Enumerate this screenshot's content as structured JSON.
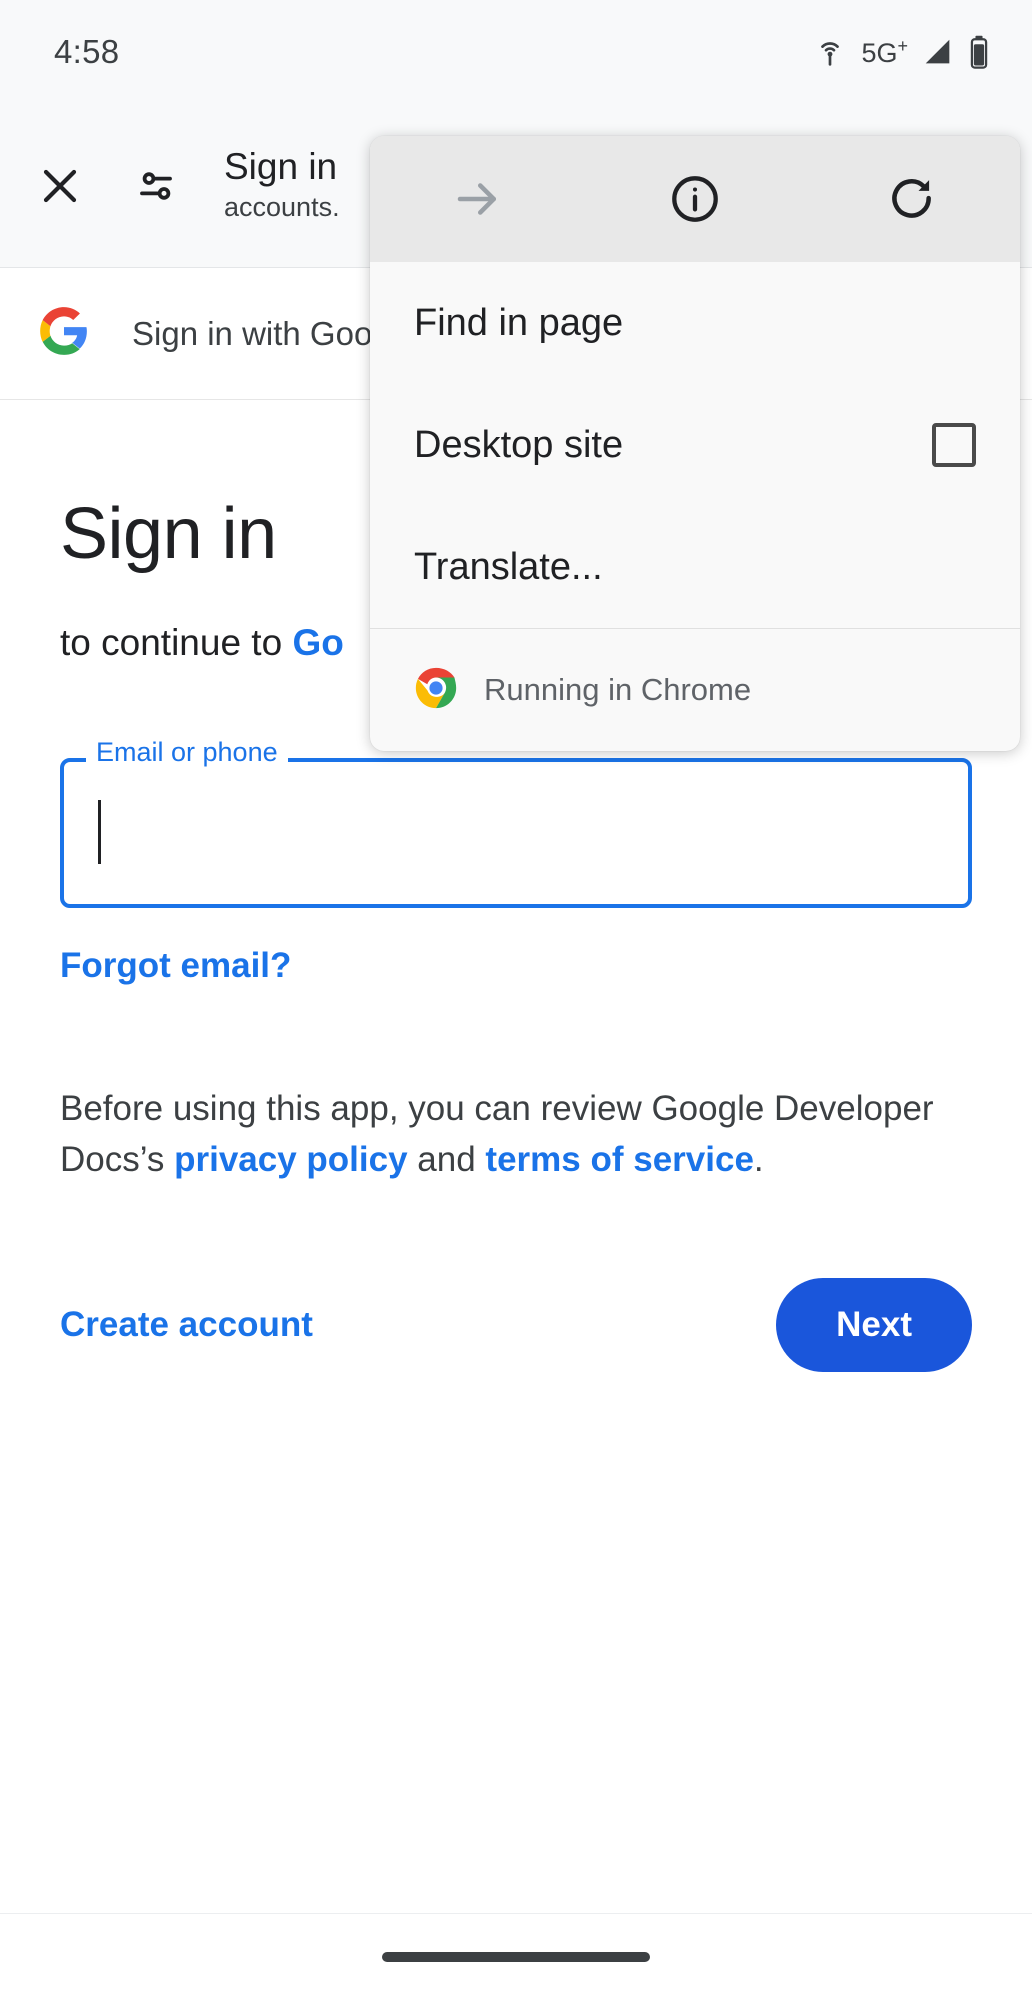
{
  "status_bar": {
    "time": "4:58",
    "network_label": "5G",
    "network_superscript": "+",
    "icons": [
      "hotspot-icon",
      "signal-icon",
      "battery-icon"
    ]
  },
  "toolbar": {
    "close_label": "close-icon",
    "page_info_label": "tune-icon",
    "title": "Sign in",
    "subtitle": "accounts."
  },
  "gsi_bar": {
    "label": "Sign in with Goo"
  },
  "page": {
    "headline": "Sign in",
    "subhead_prefix": "to continue to ",
    "subhead_link": "Go",
    "field": {
      "label": "Email or phone",
      "value": "",
      "placeholder": "Email or phone"
    },
    "forgot_email": "Forgot email?",
    "legal_text_1": "Before using this app, you can review Google Developer Docs’s ",
    "legal_link_1": "privacy policy",
    "legal_text_2": " and ",
    "legal_link_2": "terms of service",
    "legal_text_3": ".",
    "create_account": "Create account",
    "next": "Next"
  },
  "menu": {
    "header_buttons": [
      {
        "name": "forward-arrow-icon",
        "enabled": false
      },
      {
        "name": "page-info-icon",
        "enabled": true
      },
      {
        "name": "reload-icon",
        "enabled": true
      }
    ],
    "items": [
      {
        "label": "Find in page",
        "has_checkbox": false
      },
      {
        "label": "Desktop site",
        "has_checkbox": true,
        "checked": false
      },
      {
        "label": "Translate...",
        "has_checkbox": false
      }
    ],
    "footer": {
      "label": "Running in Chrome",
      "icon": "chrome-logo-icon"
    }
  },
  "colors": {
    "accent_blue": "#1a73e8",
    "button_blue": "#1a56db",
    "toolbar_bg": "#f8f9fa",
    "menu_bg": "#f9f9f9",
    "menu_header_bg": "#e8e8e8",
    "text_primary": "#202124",
    "text_secondary": "#3c4043"
  },
  "nav_bar": {
    "gesture_pill": "gesture-pill"
  }
}
